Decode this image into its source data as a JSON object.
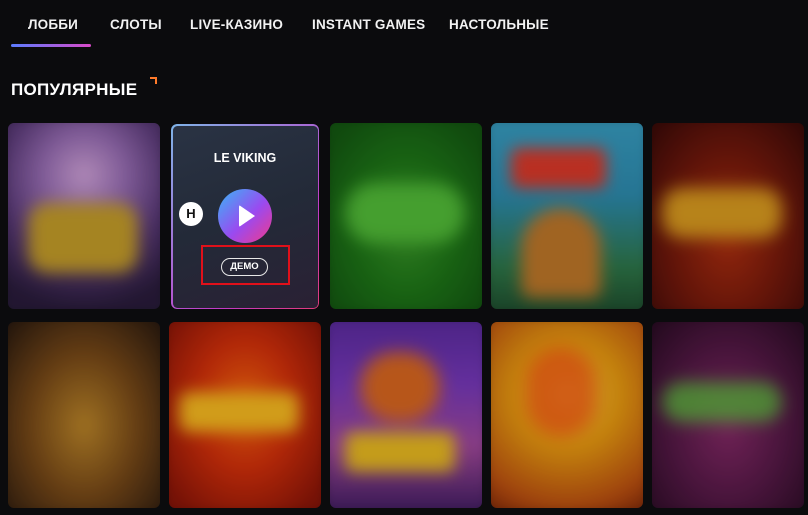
{
  "nav": {
    "tabs": [
      {
        "label": "ЛОББИ",
        "active": true
      },
      {
        "label": "СЛОТЫ"
      },
      {
        "label": "LIVE-КАЗИНО"
      },
      {
        "label": "INSTANT GAMES"
      },
      {
        "label": "НАСТОЛЬНЫЕ"
      }
    ]
  },
  "section": {
    "title": "ПОПУЛЯРНЫЕ"
  },
  "hovered_game": {
    "name": "LE VIKING",
    "provider_icon": "H",
    "demo_label": "ДЕМО"
  },
  "colors": {
    "accent_gradient_start": "#38b6f6",
    "accent_gradient_end": "#f23a8a",
    "highlight_box": "#e0101a",
    "background": "#0b0b0d"
  }
}
